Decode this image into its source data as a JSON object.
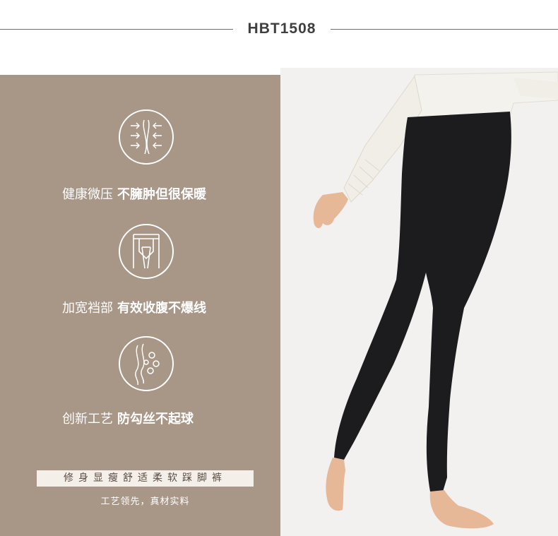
{
  "header": {
    "model_code": "HBT1508"
  },
  "features": [
    {
      "icon": "compression-arrows-icon",
      "label": "健康微压",
      "highlight": "不臃肿但很保暖"
    },
    {
      "icon": "crotch-panel-icon",
      "label": "加宽裆部",
      "highlight": "有效收腹不爆线"
    },
    {
      "icon": "fabric-fiber-icon",
      "label": "创新工艺",
      "highlight": "防勾丝不起球"
    }
  ],
  "slogan": "修身显瘦舒适柔软踩脚裤",
  "sub_slogan": "工艺领先，真材实料",
  "colors": {
    "panel": "#a89687",
    "legging": "#1c1c1e",
    "sweater": "#f4f2ec",
    "skin": "#e6b897"
  }
}
